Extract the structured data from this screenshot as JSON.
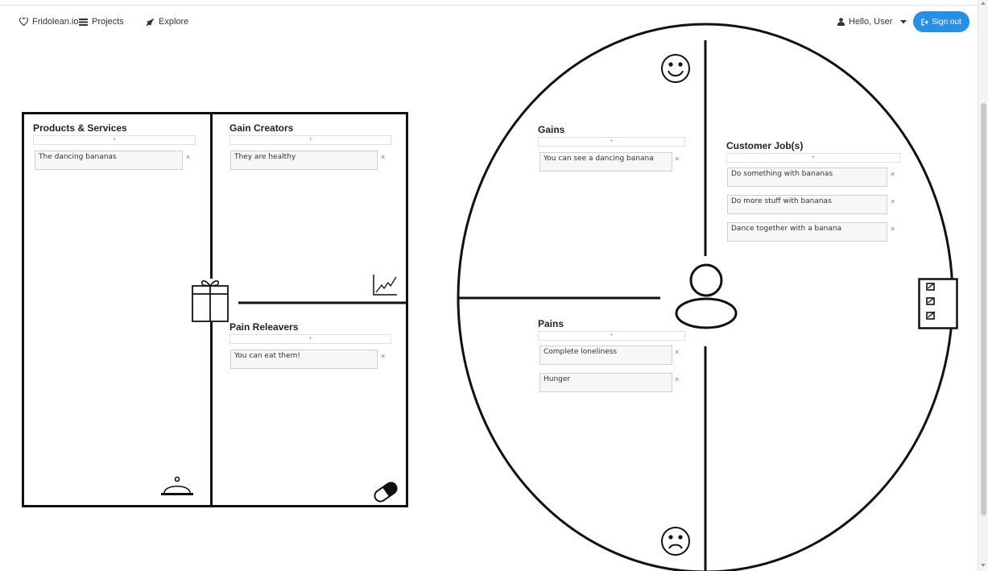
{
  "nav": {
    "brand": "Fridolean.io",
    "projects": "Projects",
    "explore": "Explore",
    "user_greeting": "Hello, User",
    "signout": "Sign out"
  },
  "value_map": {
    "products_services": {
      "title": "Products & Services",
      "add": "+",
      "items": [
        "The dancing bananas"
      ]
    },
    "gain_creators": {
      "title": "Gain Creators",
      "add": "+",
      "items": [
        "They are healthy"
      ]
    },
    "pain_relievers": {
      "title": "Pain Releavers",
      "add": "+",
      "items": [
        "You can eat them!"
      ]
    }
  },
  "customer_profile": {
    "gains": {
      "title": "Gains",
      "add": "+",
      "items": [
        "You can see a dancing banana"
      ]
    },
    "customer_jobs": {
      "title": "Customer Job(s)",
      "add": "+",
      "items": [
        "Do something with bananas",
        "Do more stuff with bananas",
        "Dance together with a banana"
      ]
    },
    "pains": {
      "title": "Pains",
      "add": "+",
      "items": [
        "Complete loneliness",
        "Hunger"
      ]
    }
  },
  "remove_symbol": "×",
  "icons": {
    "brand": "heart-outline-icon",
    "projects": "list-icon",
    "explore": "rocket-icon",
    "user": "user-icon",
    "signout": "sign-out-icon",
    "products": "gift-icon",
    "gain_creators": "chart-icon",
    "products_corner": "serving-cloche-icon",
    "pain_relievers": "pill-icon",
    "gains": "smiley-face-icon",
    "pains": "sad-face-icon",
    "customer": "person-icon",
    "jobs": "checklist-icon"
  },
  "colors": {
    "accent": "#2590e6",
    "lines": "#111111"
  }
}
